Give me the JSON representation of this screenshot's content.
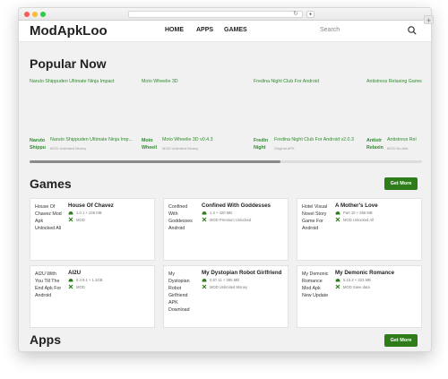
{
  "site": {
    "logo": "ModApkLoo",
    "nav": [
      "HOME",
      "APPS",
      "GAMES"
    ],
    "search_placeholder": "Search"
  },
  "browser": {
    "newtab": "+",
    "reload": "↻"
  },
  "popular": {
    "title": "Popular Now",
    "top_labels": [
      "Naruto Shippuden Ultimate Ninja Impact",
      "Moto Wheelie 3D",
      "Fredina Night Club For Android",
      "Antistress Relaxing Games"
    ],
    "items": [
      {
        "short": "Naruto Shippu",
        "name": "Naruto Shippuden Ultimate Ninja Imp...",
        "mod": "MOD Unlimited Money"
      },
      {
        "short": "Moto Wheeli",
        "name": "Moto Wheelie 3D v0.4.3",
        "mod": "MOD Unlimited Money"
      },
      {
        "short": "Fredin Night",
        "name": "Fredina Night Club For Android v2.0.3",
        "mod": "Original APK"
      },
      {
        "short": "Antistr Relaxin",
        "name": "Antistress Rel",
        "mod": "MOD No Ads"
      }
    ]
  },
  "games": {
    "title": "Games",
    "get_more": "Get More",
    "cards": [
      {
        "thumb": "House Of Chavez Mod Apk Unlocked All",
        "title": "House Of Chavez",
        "version": "1.0.1 + 248 MB",
        "mod": "MOD"
      },
      {
        "thumb": "Confined With Goddesses Android",
        "title": "Confined With Goddesses",
        "version": "1.3 + 420 MB",
        "mod": "MOD Premium Unlocked"
      },
      {
        "thumb": "Hotel Visual Novel Story Game For Android",
        "title": "A Mother's Love",
        "version": "Part 10 + 555 MB",
        "mod": "MOD Unlocked All"
      },
      {
        "thumb": "AI2U With You Till The End Apk For Android",
        "title": "AI2U",
        "version": "0.4.9.1 + 1.1GB",
        "mod": "MOD"
      },
      {
        "thumb": "My Dystopian Robot Girlfriend APK Download",
        "title": "My Dystopian Robot Girlfriend",
        "version": "0.87.11 + 385 MB",
        "mod": "MOD Unlimited Money"
      },
      {
        "thumb": "My Demonic Romance Mod Apk New Update",
        "title": "My Demonic Romance",
        "version": "5.15.2 + 323 MB",
        "mod": "MOD Save data"
      }
    ]
  },
  "apps": {
    "title": "Apps",
    "get_more": "Get More"
  },
  "colors": {
    "accent": "#2e7d1a",
    "link": "#2e8b2e"
  }
}
